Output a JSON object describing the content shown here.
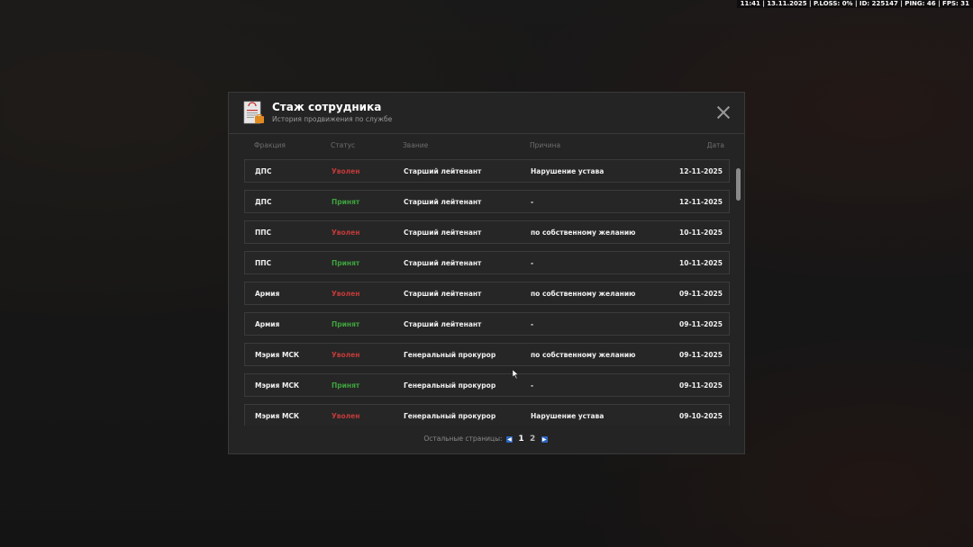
{
  "hud": {
    "stats": "11:41 | 13.11.2025 | P.LOSS: 0% | ID: 225147 | PING: 46 | FPS: 31"
  },
  "modal": {
    "title": "Стаж сотрудника",
    "subtitle": "История продвижения по службе",
    "columns": [
      "Фракция",
      "Статус",
      "Звание",
      "Причина",
      "Дата"
    ],
    "rows": [
      {
        "faction": "ДПС",
        "status": "Уволен",
        "status_type": "fired",
        "rank": "Старший лейтенант",
        "reason": "Нарушение устава",
        "date": "12-11-2025"
      },
      {
        "faction": "ДПС",
        "status": "Принят",
        "status_type": "hired",
        "rank": "Старший лейтенант",
        "reason": "-",
        "date": "12-11-2025"
      },
      {
        "faction": "ППС",
        "status": "Уволен",
        "status_type": "fired",
        "rank": "Старший лейтенант",
        "reason": "по собственному желанию",
        "date": "10-11-2025"
      },
      {
        "faction": "ППС",
        "status": "Принят",
        "status_type": "hired",
        "rank": "Старший лейтенант",
        "reason": "-",
        "date": "10-11-2025"
      },
      {
        "faction": "Армия",
        "status": "Уволен",
        "status_type": "fired",
        "rank": "Старший лейтенант",
        "reason": "по собственному желанию",
        "date": "09-11-2025"
      },
      {
        "faction": "Армия",
        "status": "Принят",
        "status_type": "hired",
        "rank": "Старший лейтенант",
        "reason": "-",
        "date": "09-11-2025"
      },
      {
        "faction": "Мэрия МСК",
        "status": "Уволен",
        "status_type": "fired",
        "rank": "Генеральный прокурор",
        "reason": "по собственному желанию",
        "date": "09-11-2025"
      },
      {
        "faction": "Мэрия МСК",
        "status": "Принят",
        "status_type": "hired",
        "rank": "Генеральный прокурор",
        "reason": "-",
        "date": "09-11-2025"
      },
      {
        "faction": "Мэрия МСК",
        "status": "Уволен",
        "status_type": "fired",
        "rank": "Генеральный прокурор",
        "reason": "Нарушение устава",
        "date": "09-10-2025"
      }
    ],
    "pager": {
      "label": "Остальные страницы:",
      "pages": [
        "1",
        "2"
      ],
      "current": "1"
    }
  },
  "colors": {
    "fired": "#c23a3a",
    "hired": "#3ea33e",
    "accent": "#2d66c2"
  },
  "icons": {
    "header": "document-icon",
    "close": "close-icon",
    "prev": "arrow-left-icon",
    "next": "arrow-right-icon"
  }
}
